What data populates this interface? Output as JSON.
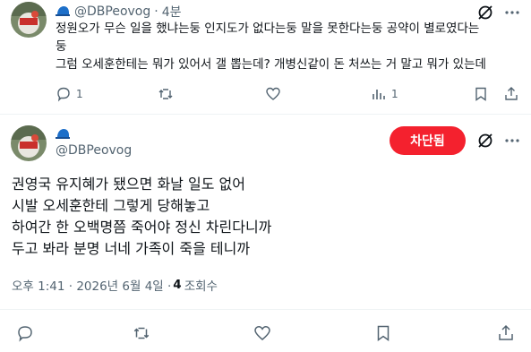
{
  "reply": {
    "handle": "@DBPeovog",
    "separator": "·",
    "time": "4분",
    "text_line1": "정원오가 무슨 일을 했냐는둥 인지도가 없다는둥 말을 못한다는둥 공약이 별로였다는",
    "text_line2": "둥",
    "text_line3": "그럼 오세훈한테는 뭐가 있어서 갤 뽑는데? 개병신같이 돈 처쓰는 거 말고 뭐가 있는데",
    "reply_count": "1",
    "views_count": "1"
  },
  "main": {
    "handle": "@DBPeovog",
    "blocked_label": "차단됨",
    "lines": [
      "권영국 유지혜가 됐으면 화날 일도 없어",
      "시발 오세훈한테 그렇게 당해놓고",
      "하여간 한 오백명쯤 죽어야 정신 차린다니까",
      "두고 봐라 분명 너네 가족이 죽을 테니까"
    ],
    "timestamp": "오후 1:41 · 2026년 6월 4일 ·",
    "views_number": "4",
    "views_label": "조회수"
  },
  "colors": {
    "block_red": "#f4212e",
    "muted": "#536471",
    "text": "#0f1419",
    "cap_blue": "#1d6fc9"
  }
}
